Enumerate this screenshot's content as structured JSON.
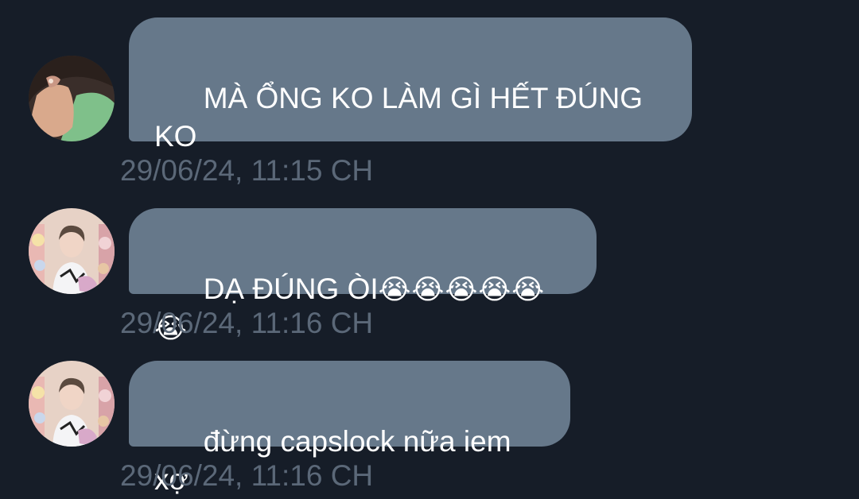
{
  "messages": [
    {
      "sender": "avatar-a",
      "text": "MÀ ỔNG KO LÀM GÌ HẾT ĐÚNG\nKO",
      "emoji": "",
      "timestamp": "29/06/24, 11:15 CH"
    },
    {
      "sender": "avatar-b",
      "text": "DẠ ĐÚNG ÒI",
      "emoji": "😭😭😭😭😭😭",
      "timestamp": "29/06/24, 11:16 CH"
    },
    {
      "sender": "avatar-b",
      "text": "đừng capslock nữa iem xợ",
      "emoji": "",
      "timestamp": "29/06/24, 11:16 CH"
    }
  ],
  "colors": {
    "background": "#161d28",
    "bubble": "#66788a",
    "timestamp": "#5b6878",
    "text": "#ffffff"
  }
}
